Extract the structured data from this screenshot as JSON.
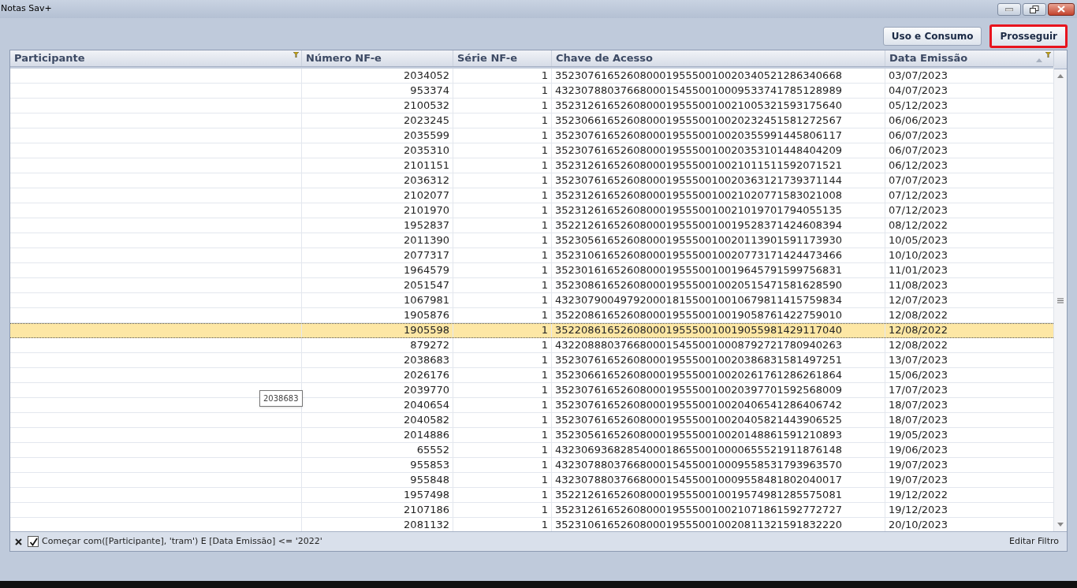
{
  "window": {
    "title": "Notas Sav+"
  },
  "buttons": [
    {
      "label": "Uso e Consumo",
      "highlighted": false
    },
    {
      "label": "Prosseguir",
      "highlighted": true
    }
  ],
  "table": {
    "columns": [
      {
        "label": "Participante",
        "filtered": true,
        "sorted": false
      },
      {
        "label": "Número NF-e",
        "filtered": false,
        "sorted": false
      },
      {
        "label": "Série NF-e",
        "filtered": false,
        "sorted": false
      },
      {
        "label": "Chave de Acesso",
        "filtered": false,
        "sorted": false
      },
      {
        "label": "Data Emissão",
        "filtered": true,
        "sorted": true
      }
    ],
    "rows": [
      {
        "cells": [
          "",
          "2034052",
          "1",
          "35230761652608000195550010020340521286340668",
          "03/07/2023"
        ],
        "selected": false
      },
      {
        "cells": [
          "",
          "953374",
          "1",
          "43230788037668000154550010009533741785128989",
          "04/07/2023"
        ],
        "selected": false
      },
      {
        "cells": [
          "",
          "2100532",
          "1",
          "35231261652608000195550010021005321593175640",
          "05/12/2023"
        ],
        "selected": false
      },
      {
        "cells": [
          "",
          "2023245",
          "1",
          "35230661652608000195550010020232451581272567",
          "06/06/2023"
        ],
        "selected": false
      },
      {
        "cells": [
          "",
          "2035599",
          "1",
          "35230761652608000195550010020355991445806117",
          "06/07/2023"
        ],
        "selected": false
      },
      {
        "cells": [
          "",
          "2035310",
          "1",
          "35230761652608000195550010020353101448404209",
          "06/07/2023"
        ],
        "selected": false
      },
      {
        "cells": [
          "",
          "2101151",
          "1",
          "35231261652608000195550010021011511592071521",
          "06/12/2023"
        ],
        "selected": false
      },
      {
        "cells": [
          "",
          "2036312",
          "1",
          "35230761652608000195550010020363121739371144",
          "07/07/2023"
        ],
        "selected": false
      },
      {
        "cells": [
          "",
          "2102077",
          "1",
          "35231261652608000195550010021020771583021008",
          "07/12/2023"
        ],
        "selected": false
      },
      {
        "cells": [
          "",
          "2101970",
          "1",
          "35231261652608000195550010021019701794055135",
          "07/12/2023"
        ],
        "selected": false
      },
      {
        "cells": [
          "",
          "1952837",
          "1",
          "35221261652608000195550010019528371424608394",
          "08/12/2022"
        ],
        "selected": false
      },
      {
        "cells": [
          "",
          "2011390",
          "1",
          "35230561652608000195550010020113901591173930",
          "10/05/2023"
        ],
        "selected": false
      },
      {
        "cells": [
          "",
          "2077317",
          "1",
          "35231061652608000195550010020773171424473466",
          "10/10/2023"
        ],
        "selected": false
      },
      {
        "cells": [
          "",
          "1964579",
          "1",
          "35230161652608000195550010019645791599756831",
          "11/01/2023"
        ],
        "selected": false
      },
      {
        "cells": [
          "",
          "2051547",
          "1",
          "35230861652608000195550010020515471581628590",
          "11/08/2023"
        ],
        "selected": false
      },
      {
        "cells": [
          "",
          "1067981",
          "1",
          "43230790049792000181550010010679811415759834",
          "12/07/2023"
        ],
        "selected": false
      },
      {
        "cells": [
          "",
          "1905876",
          "1",
          "35220861652608000195550010019058761422759010",
          "12/08/2022"
        ],
        "selected": false
      },
      {
        "cells": [
          "",
          "1905598",
          "1",
          "35220861652608000195550010019055981429117040",
          "12/08/2022"
        ],
        "selected": true
      },
      {
        "cells": [
          "",
          "879272",
          "1",
          "43220888037668000154550010008792721780940263",
          "12/08/2022"
        ],
        "selected": false
      },
      {
        "cells": [
          "",
          "2038683",
          "1",
          "35230761652608000195550010020386831581497251",
          "13/07/2023"
        ],
        "selected": false
      },
      {
        "cells": [
          "",
          "2026176",
          "1",
          "35230661652608000195550010020261761286261864",
          "15/06/2023"
        ],
        "selected": false
      },
      {
        "cells": [
          "",
          "2039770",
          "1",
          "35230761652608000195550010020397701592568009",
          "17/07/2023"
        ],
        "selected": false
      },
      {
        "cells": [
          "",
          "2040654",
          "1",
          "35230761652608000195550010020406541286406742",
          "18/07/2023"
        ],
        "selected": false
      },
      {
        "cells": [
          "",
          "2040582",
          "1",
          "35230761652608000195550010020405821443906525",
          "18/07/2023"
        ],
        "selected": false
      },
      {
        "cells": [
          "",
          "2014886",
          "1",
          "35230561652608000195550010020148861591210893",
          "19/05/2023"
        ],
        "selected": false
      },
      {
        "cells": [
          "",
          "65552",
          "1",
          "43230693682854000186550010000655521911876148",
          "19/06/2023"
        ],
        "selected": false
      },
      {
        "cells": [
          "",
          "955853",
          "1",
          "43230788037668000154550010009558531793963570",
          "19/07/2023"
        ],
        "selected": false
      },
      {
        "cells": [
          "",
          "955848",
          "1",
          "43230788037668000154550010009558481802040017",
          "19/07/2023"
        ],
        "selected": false
      },
      {
        "cells": [
          "",
          "1957498",
          "1",
          "35221261652608000195550010019574981285575081",
          "19/12/2022"
        ],
        "selected": false
      },
      {
        "cells": [
          "",
          "2107186",
          "1",
          "35231261652608000195550010021071861592772727",
          "19/12/2023"
        ],
        "selected": false
      },
      {
        "cells": [
          "",
          "2081132",
          "1",
          "35231061652608000195550010020811321591832220",
          "20/10/2023"
        ],
        "selected": false
      }
    ]
  },
  "tooltip": {
    "text": "2038683"
  },
  "filter_bar": {
    "enabled": true,
    "expression": "Começar com([Participante], 'tram') E [Data Emissão] <= '2022'",
    "edit_link": "Editar Filtro"
  }
}
